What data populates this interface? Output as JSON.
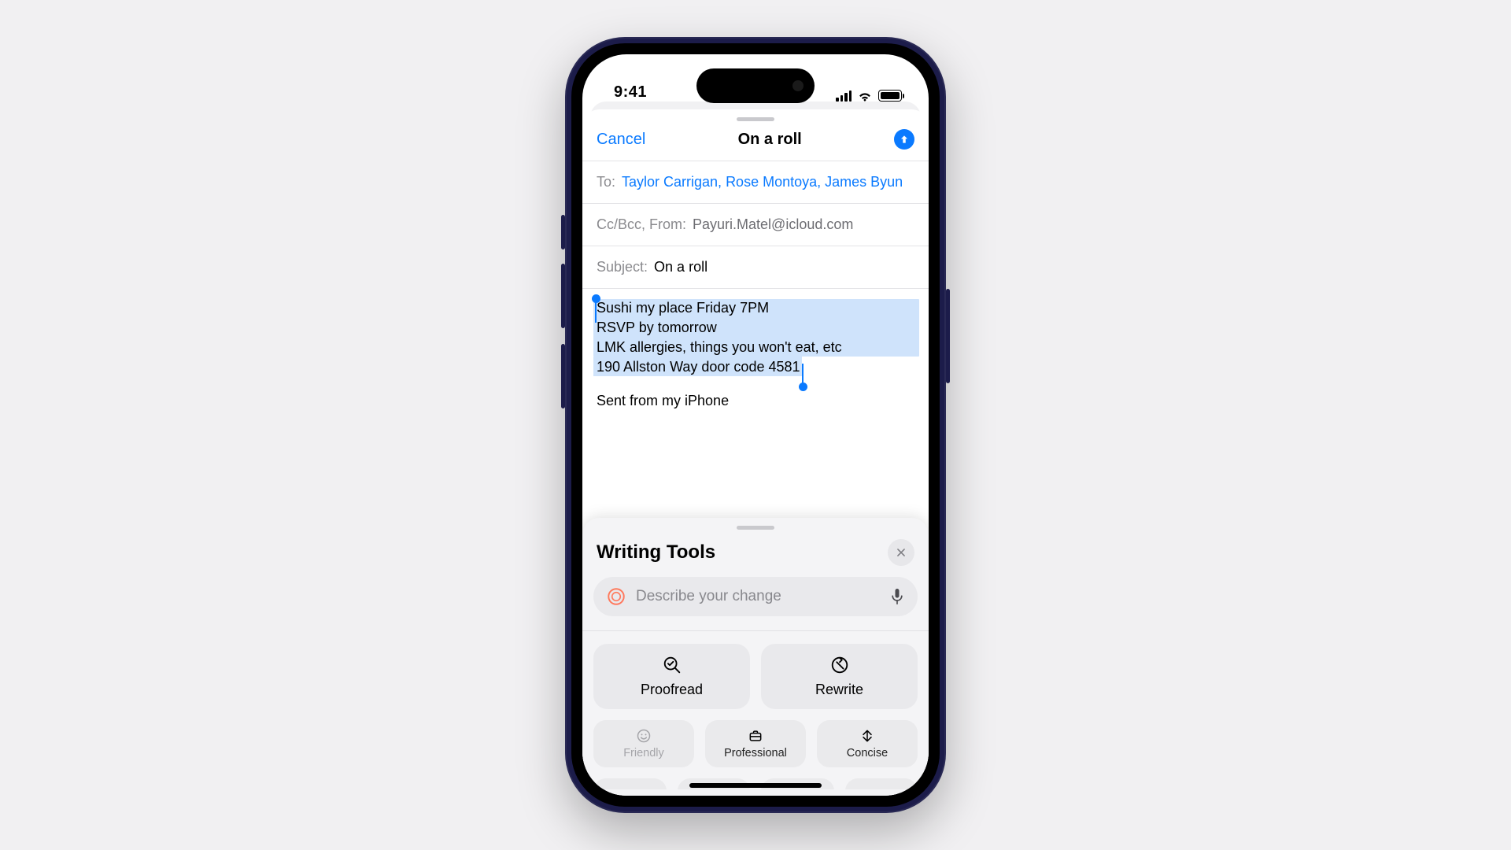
{
  "statusbar": {
    "time": "9:41"
  },
  "compose": {
    "cancel": "Cancel",
    "title": "On a roll",
    "to_label": "To:",
    "recipients": "Taylor Carrigan, Rose Montoya, James Byun",
    "ccbcc_label": "Cc/Bcc, From:",
    "from_address": "Payuri.Matel@icloud.com",
    "subject_label": "Subject:",
    "subject_value": "On a roll",
    "selected_lines": [
      "Sushi my place Friday 7PM",
      "RSVP by tomorrow",
      "LMK allergies, things you won't eat, etc",
      "190 Allston Way door code 4581"
    ],
    "signature": "Sent from my iPhone"
  },
  "tools": {
    "title": "Writing Tools",
    "describe_placeholder": "Describe your change",
    "proofread": "Proofread",
    "rewrite": "Rewrite",
    "friendly": "Friendly",
    "professional": "Professional",
    "concise": "Concise"
  }
}
